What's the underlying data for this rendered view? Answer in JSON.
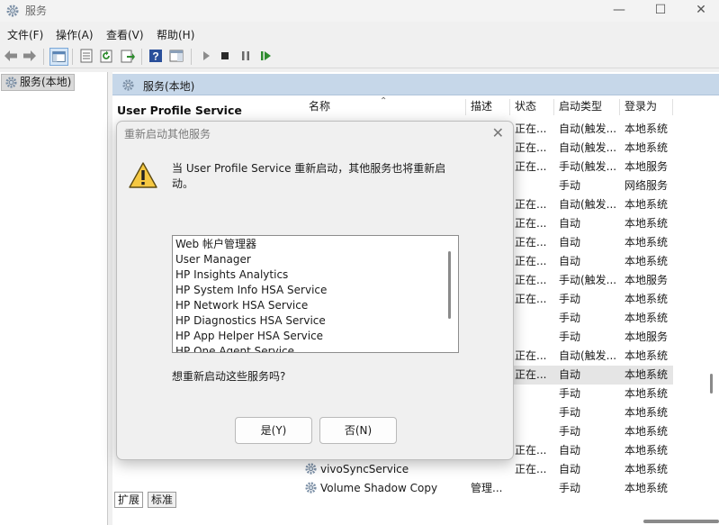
{
  "window": {
    "title": "服务",
    "min": "—",
    "max": "☐",
    "close": "✕"
  },
  "menu": [
    "文件(F)",
    "操作(A)",
    "查看(V)",
    "帮助(H)"
  ],
  "tree": {
    "item": "服务(本地)"
  },
  "pane": {
    "header": "服务(本地)",
    "selected_service": "User Profile Service",
    "columns": {
      "name": "名称",
      "desc": "描述",
      "status": "状态",
      "startup": "启动类型",
      "logon": "登录为"
    },
    "rows": [
      {
        "name": "",
        "desc": "",
        "status": "正在...",
        "startup": "自动(触发...",
        "logon": "本地系统"
      },
      {
        "name": "",
        "desc": "",
        "status": "正在...",
        "startup": "自动(触发...",
        "logon": "本地系统"
      },
      {
        "name": "",
        "desc": "",
        "status": "正在...",
        "startup": "手动(触发...",
        "logon": "本地服务"
      },
      {
        "name": "",
        "desc": "",
        "status": "",
        "startup": "手动",
        "logon": "网络服务"
      },
      {
        "name": "",
        "desc": "",
        "status": "正在...",
        "startup": "自动(触发...",
        "logon": "本地系统"
      },
      {
        "name": "",
        "desc": "",
        "status": "正在...",
        "startup": "自动",
        "logon": "本地系统"
      },
      {
        "name": "",
        "desc": "",
        "status": "正在...",
        "startup": "自动",
        "logon": "本地系统"
      },
      {
        "name": "",
        "desc": "",
        "status": "正在...",
        "startup": "自动",
        "logon": "本地系统"
      },
      {
        "name": "",
        "desc": "",
        "status": "正在...",
        "startup": "手动(触发...",
        "logon": "本地服务"
      },
      {
        "name": "",
        "desc": "",
        "status": "正在...",
        "startup": "手动",
        "logon": "本地系统"
      },
      {
        "name": "",
        "desc": "",
        "status": "",
        "startup": "手动",
        "logon": "本地系统"
      },
      {
        "name": "",
        "desc": "",
        "status": "",
        "startup": "手动",
        "logon": "本地服务"
      },
      {
        "name": "",
        "desc": "",
        "status": "正在...",
        "startup": "自动(触发...",
        "logon": "本地系统"
      },
      {
        "name": "",
        "desc": "",
        "status": "正在...",
        "startup": "自动",
        "logon": "本地系统"
      },
      {
        "name": "",
        "desc": "",
        "status": "",
        "startup": "手动",
        "logon": "本地系统"
      },
      {
        "name": "",
        "desc": "",
        "status": "",
        "startup": "手动",
        "logon": "本地系统"
      },
      {
        "name": "",
        "desc": "",
        "status": "",
        "startup": "手动",
        "logon": "本地系统"
      },
      {
        "name": "",
        "desc": "",
        "status": "正在...",
        "startup": "自动",
        "logon": "本地系统"
      },
      {
        "name": "vivoSyncService",
        "desc": "",
        "status": "正在...",
        "startup": "自动",
        "logon": "本地系统"
      },
      {
        "name": "Volume Shadow Copy",
        "desc": "管理...",
        "status": "",
        "startup": "手动",
        "logon": "本地系统"
      }
    ],
    "tabs": [
      "扩展",
      "标准"
    ]
  },
  "dialog": {
    "title": "重新启动其他服务",
    "close": "✕",
    "message": "当 User Profile Service 重新启动，其他服务也将重新启动。",
    "services": [
      "Web 帐户管理器",
      "User Manager",
      "HP Insights Analytics",
      "HP System Info HSA Service",
      "HP Network HSA Service",
      "HP Diagnostics HSA Service",
      "HP App Helper HSA Service",
      "HP One Agent Service"
    ],
    "question": "想重新启动这些服务吗?",
    "yes": "是(Y)",
    "no": "否(N)"
  }
}
